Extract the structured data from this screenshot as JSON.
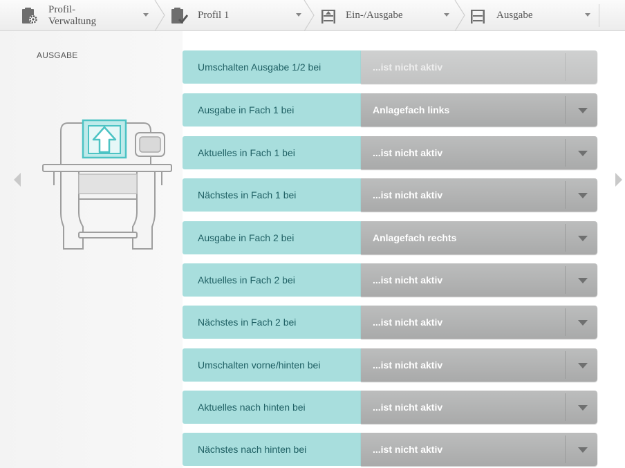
{
  "breadcrumb": {
    "items": [
      {
        "label_line1": "Profil-",
        "label_line2": "Verwaltung",
        "icon": "clipboard-gear-icon"
      },
      {
        "label": "Profil 1",
        "icon": "clipboard-check-icon"
      },
      {
        "label": "Ein-/Ausgabe",
        "icon": "tray-io-icon"
      },
      {
        "label": "Ausgabe",
        "icon": "tray-output-icon"
      }
    ]
  },
  "panel": {
    "title": "AUSGABE",
    "illustration": "printer-output-tray-illustration"
  },
  "settings": [
    {
      "label": "Umschalten Ausgabe 1/2 bei",
      "value": "...ist nicht aktiv",
      "enabled": false
    },
    {
      "label": "Ausgabe in Fach 1 bei",
      "value": "Anlagefach links",
      "enabled": true
    },
    {
      "label": "Aktuelles in Fach 1 bei",
      "value": "...ist nicht aktiv",
      "enabled": true
    },
    {
      "label": "Nächstes in Fach 1 bei",
      "value": "...ist nicht aktiv",
      "enabled": true
    },
    {
      "label": "Ausgabe in Fach 2 bei",
      "value": "Anlagefach rechts",
      "enabled": true
    },
    {
      "label": "Aktuelles in Fach 2 bei",
      "value": "...ist nicht aktiv",
      "enabled": true
    },
    {
      "label": "Nächstes in Fach 2 bei",
      "value": "...ist nicht aktiv",
      "enabled": true
    },
    {
      "label": "Umschalten vorne/hinten bei",
      "value": "...ist nicht aktiv",
      "enabled": true
    },
    {
      "label": "Aktuelles nach hinten bei",
      "value": "...ist nicht aktiv",
      "enabled": true
    },
    {
      "label": "Nächstes nach hinten bei",
      "value": "...ist nicht aktiv",
      "enabled": true
    }
  ],
  "colors": {
    "label_bg": "#a8dedd",
    "label_text": "#1e5f63",
    "select_bg": "#b0b1b1",
    "accent_teal": "#4cc3c4"
  }
}
